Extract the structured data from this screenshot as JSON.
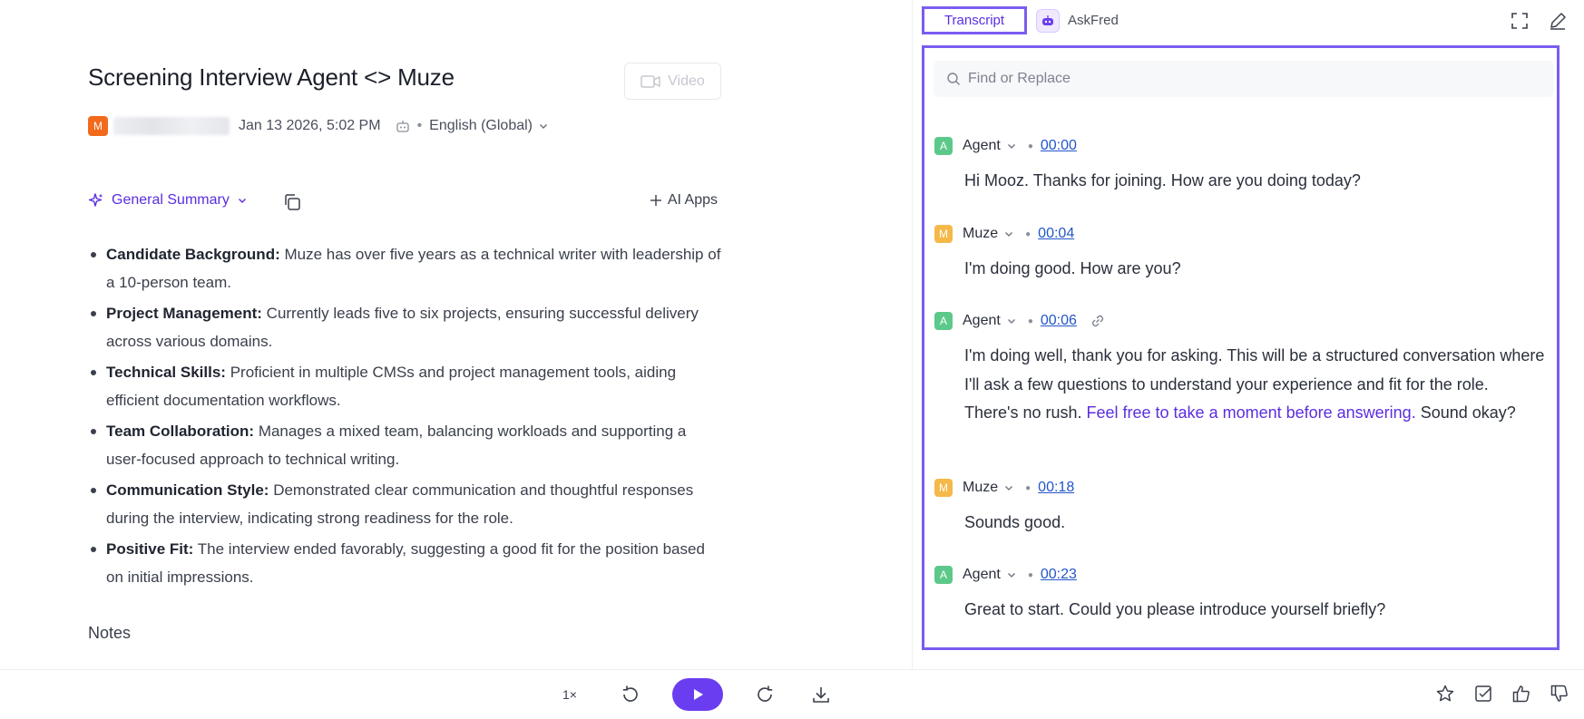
{
  "header": {
    "title": "Screening Interview Agent <> Muze",
    "video_label": "Video",
    "owner_initial": "M",
    "date": "Jan 13 2026, 5:02 PM",
    "language": "English (Global)"
  },
  "summary": {
    "selector_label": "General Summary",
    "ai_apps_label": "AI Apps",
    "items": [
      {
        "heading": "Candidate Background:",
        "text": " Muze has over five years as a technical writer with leadership of a 10-person team."
      },
      {
        "heading": "Project Management:",
        "text": " Currently leads five to six projects, ensuring successful delivery across various domains."
      },
      {
        "heading": "Technical Skills:",
        "text": " Proficient in multiple CMSs and project management tools, aiding efficient documentation workflows."
      },
      {
        "heading": "Team Collaboration:",
        "text": " Manages a mixed team, balancing workloads and supporting a user-focused approach to technical writing."
      },
      {
        "heading": "Communication Style:",
        "text": " Demonstrated clear communication and thoughtful responses during the interview, indicating strong readiness for the role."
      },
      {
        "heading": "Positive Fit:",
        "text": " The interview ended favorably, suggesting a good fit for the position based on initial impressions."
      }
    ],
    "notes_heading": "Notes"
  },
  "panel": {
    "tab_transcript": "Transcript",
    "tab_askfred": "AskFred",
    "search_placeholder": "Find or Replace"
  },
  "transcript": [
    {
      "initial": "A",
      "speaker": "Agent",
      "time": "00:00",
      "color": "#5cc98a",
      "text": "Hi Mooz. Thanks for joining. How are you doing today?"
    },
    {
      "initial": "M",
      "speaker": "Muze",
      "time": "00:04",
      "color": "#f5b94a",
      "text": "I'm doing good. How are you?"
    },
    {
      "initial": "A",
      "speaker": "Agent",
      "time": "00:06",
      "color": "#5cc98a",
      "text_before": "I'm doing well, thank you for asking. This will be a structured conversation where I'll ask a few questions to understand your experience and fit for the role. There's no rush. ",
      "text_highlight": "Feel free to take a moment before answering.",
      "text_after": " Sound okay?"
    },
    {
      "initial": "M",
      "speaker": "Muze",
      "time": "00:18",
      "color": "#f5b94a",
      "text": "Sounds good."
    },
    {
      "initial": "A",
      "speaker": "Agent",
      "time": "00:23",
      "color": "#5cc98a",
      "text": "Great to start. Could you please introduce yourself briefly?"
    }
  ],
  "player": {
    "speed": "1×"
  },
  "colors": {
    "accent": "#6a3df0",
    "highlight_border": "#7b5cf0",
    "link": "#2356c8",
    "owner_avatar": "#f26a1b"
  }
}
